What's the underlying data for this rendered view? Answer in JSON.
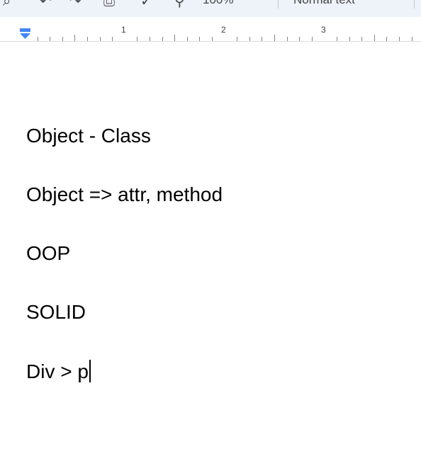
{
  "toolbar": {
    "zoom_value": "100%",
    "text_style": "Normal text",
    "icons": [
      "search-icon",
      "undo-icon",
      "redo-icon",
      "print-icon",
      "spellcheck-icon",
      "paint-format-icon"
    ]
  },
  "ruler": {
    "numbers": [
      "1",
      "2",
      "3"
    ]
  },
  "document": {
    "lines": [
      "Object - Class",
      "Object => attr, method",
      "OOP",
      "SOLID",
      "Div > p"
    ]
  },
  "colors": {
    "toolbar_bg": "#eef2f9",
    "indent_marker": "#4285f4",
    "text": "#000000"
  }
}
